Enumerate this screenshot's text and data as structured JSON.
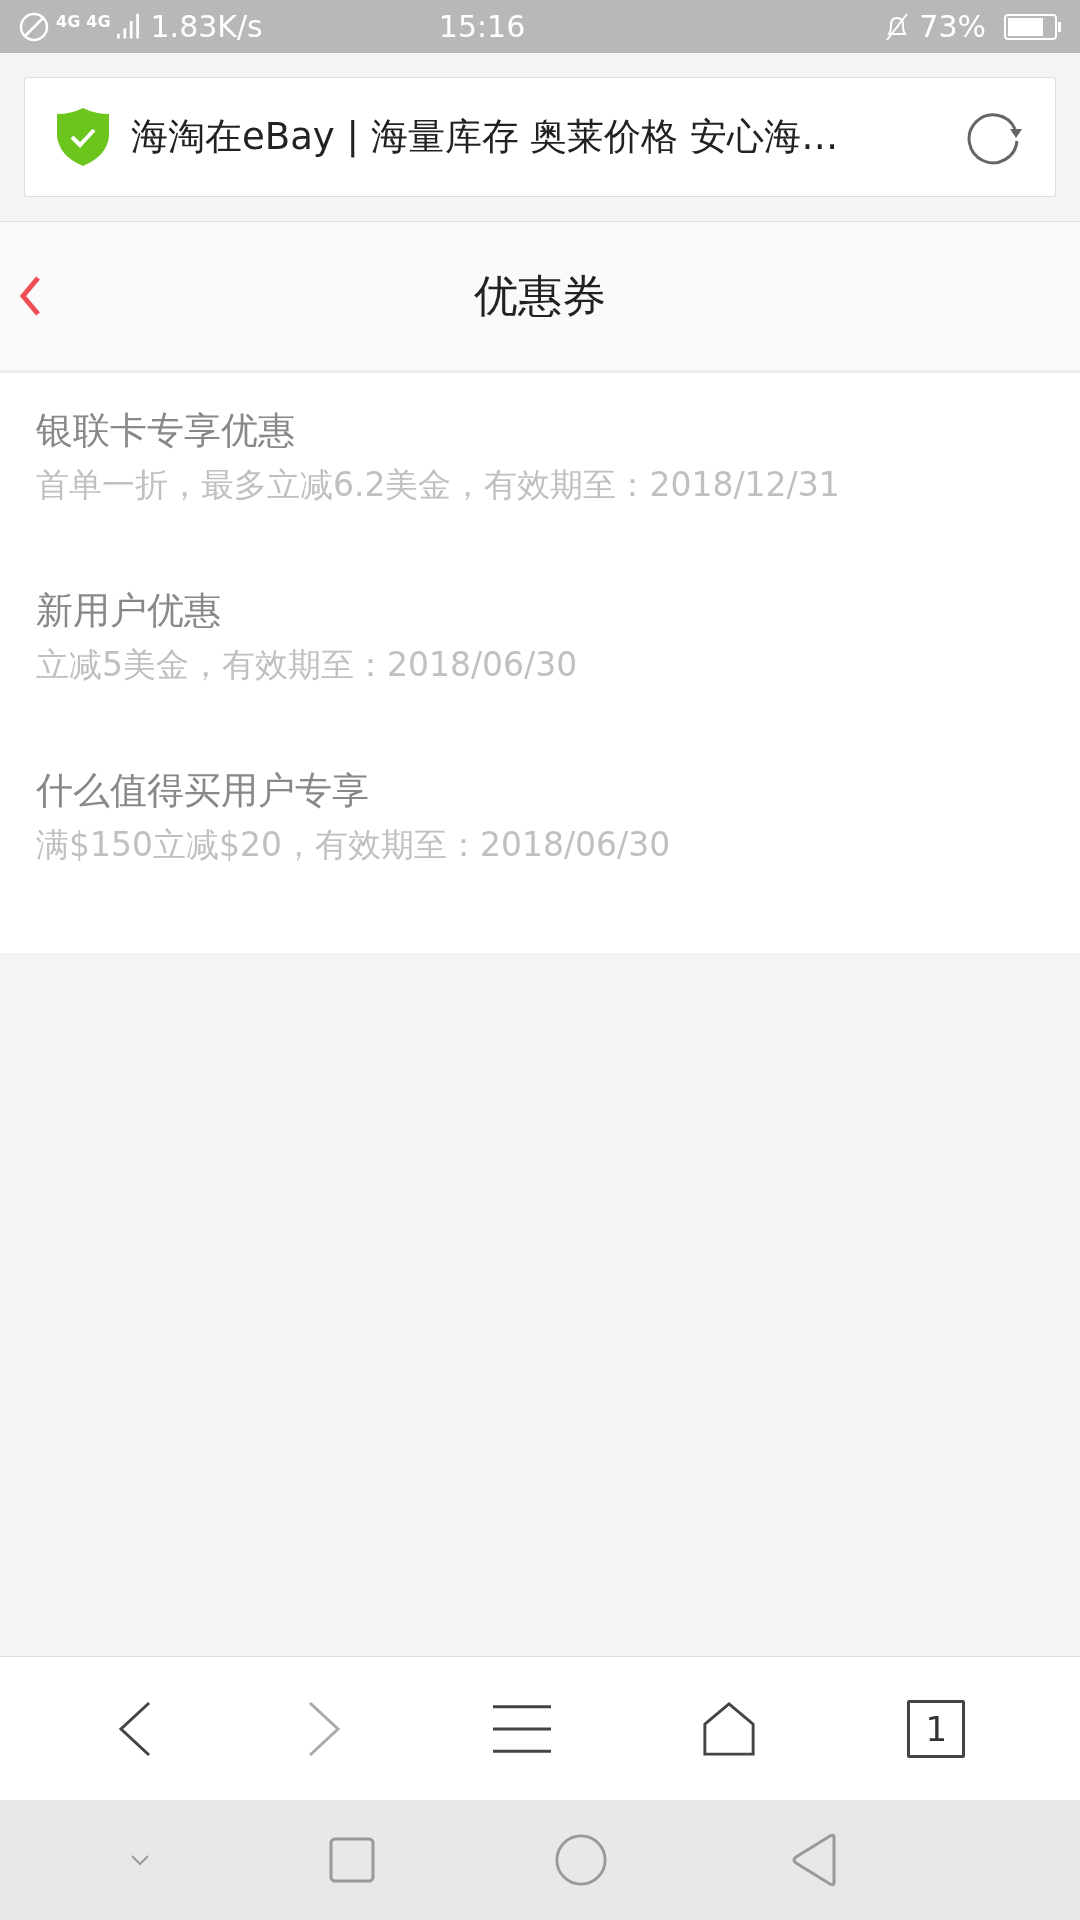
{
  "status_bar": {
    "network_1": "4G",
    "network_2": "4G",
    "speed": "1.83K/s",
    "time": "15:16",
    "battery": "73%"
  },
  "address_bar": {
    "title": "海淘在eBay | 海量库存 奥莱价格 安心海…"
  },
  "header": {
    "title": "优惠券"
  },
  "coupons": [
    {
      "title": "银联卡专享优惠",
      "detail": "首单一折，最多立减6.2美金，有效期至：2018/12/31"
    },
    {
      "title": "新用户优惠",
      "detail": "立减5美金，有效期至：2018/06/30"
    },
    {
      "title": "什么值得买用户专享",
      "detail": "满$150立减$20，有效期至：2018/06/30"
    }
  ],
  "toolbar": {
    "tab_count": "1"
  }
}
